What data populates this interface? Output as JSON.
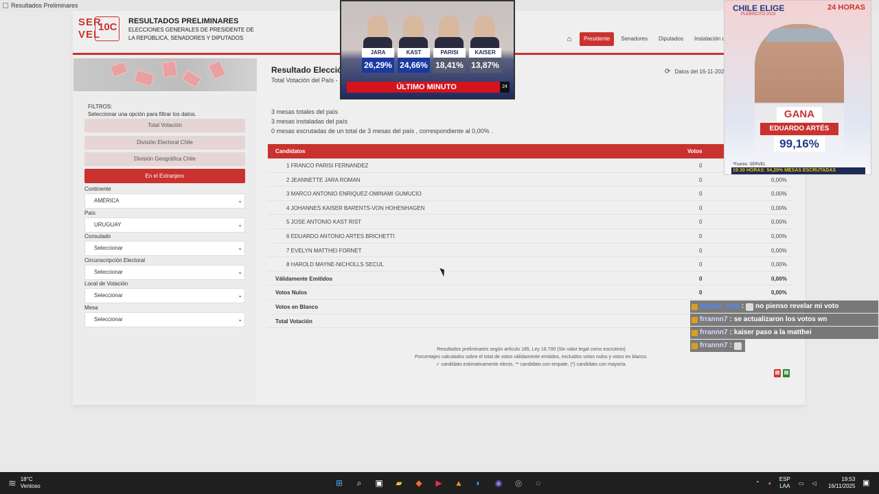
{
  "window": {
    "title": "Resultados Preliminares"
  },
  "header": {
    "logo": {
      "ser": "SER",
      "vel": "VEL",
      "badge": "10C"
    },
    "title": "RESULTADOS PRELIMINARES",
    "subtitle": "ELECCIONES GENERALES DE PRESIDENTE DE LA REPÚBLICA, SENADORES Y DIPUTADOS",
    "nav": [
      {
        "label": "Presidente",
        "active": true
      },
      {
        "label": "Senadores"
      },
      {
        "label": "Diputados"
      },
      {
        "label": "Instalación de M"
      }
    ]
  },
  "sidebar": {
    "filtros_title": "FILTROS:",
    "filtros_help": "Seleccionar una opción para filtrar los datos.",
    "buttons": [
      "Total Votación",
      "División Electoral Chile",
      "División Geográfica Chile",
      "En el Extranjero"
    ],
    "fields": [
      {
        "label": "Continente",
        "value": "AMÉRICA"
      },
      {
        "label": "País",
        "value": "URUGUAY"
      },
      {
        "label": "Consulado",
        "value": "Seleccionar"
      },
      {
        "label": "Circunscripción Electoral",
        "value": "Seleccionar"
      },
      {
        "label": "Local de Votación",
        "value": "Seleccionar"
      },
      {
        "label": "Mesa",
        "value": "Seleccionar"
      }
    ]
  },
  "main": {
    "title": "Resultado Elección",
    "subtitle": "Total Votación del País -",
    "date": "Datos del 16-11-2025",
    "stats": [
      "3 mesas totales del país",
      "3 mesas instaladas del país",
      "0 mesas escrutadas de un total de 3 mesas del país , correspondiente al 0,00% ."
    ],
    "table": {
      "headers": [
        "Candidatos",
        "Votos"
      ],
      "rows": [
        {
          "name": "1 FRANCO PARISI FERNANDEZ",
          "votes": "0",
          "pct": ""
        },
        {
          "name": "2 JEANNETTE JARA ROMAN",
          "votes": "0",
          "pct": "0,00%"
        },
        {
          "name": "3 MARCO ANTONIO ENRIQUEZ-OMINAMI GUMUCIO",
          "votes": "0",
          "pct": "0,00%"
        },
        {
          "name": "4 JOHANNES KAISER BARENTS-VON HOHENHAGEN",
          "votes": "0",
          "pct": "0,00%"
        },
        {
          "name": "5 JOSE ANTONIO KAST RIST",
          "votes": "0",
          "pct": "0,00%"
        },
        {
          "name": "6 EDUARDO ANTONIO ARTES BRICHETTI",
          "votes": "0",
          "pct": "0,00%"
        },
        {
          "name": "7 EVELYN MATTHEI FORNET",
          "votes": "0",
          "pct": "0,00%"
        },
        {
          "name": "8 HAROLD MAYNE-NICHOLLS SECUL",
          "votes": "0",
          "pct": "0,00%"
        }
      ],
      "totals": [
        {
          "name": "Válidamente Emitidos",
          "votes": "0",
          "pct": "0,00%"
        },
        {
          "name": "Votos Nulos",
          "votes": "0",
          "pct": "0,00%"
        },
        {
          "name": "Votos en Blanco",
          "votes": "",
          "pct": ""
        },
        {
          "name": "Total Votación",
          "votes": "",
          "pct": ""
        }
      ]
    },
    "notes": [
      "Resultados preliminares según artículo 185, Ley 18.700 (Sin valor legal como escrutinio)",
      "Porcentajes calculados sobre el total de votos válidamente emitidos, excluidos votos nulos y votos en blanco.",
      "✓ candidato estimativamente electo, ** candidato con empate, (*) candidato con mayoría."
    ]
  },
  "news_overlay": {
    "candidates": [
      {
        "name": "JARA",
        "pct": "26,29%"
      },
      {
        "name": "KAST",
        "pct": "24,66%"
      },
      {
        "name": "PARISI",
        "pct": "18,41%"
      },
      {
        "name": "KAISER",
        "pct": "13,87%"
      }
    ],
    "banner": "ÚLTIMO MINUTO",
    "channel": "24"
  },
  "result_overlay": {
    "brand": "CHILE ELIGE",
    "sub": "PLEBISCITO 2023",
    "channel": "24 HORAS",
    "gana": "GANA",
    "name": "EDUARDO ARTÉS",
    "pct": "99,16%",
    "fuente": "*Fuente: SERVEL",
    "escrutadas": "19:30 HORAS: 54,20% MESAS ESCRUTADAS"
  },
  "chat": [
    {
      "user": "felipee_cmb",
      "msg": "no pienso revelar mi voto",
      "blue": true
    },
    {
      "user": "frrannn7",
      "msg": "se actualizaron los votos wn"
    },
    {
      "user": "frrannn7",
      "msg": "kaiser paso a la matthei"
    },
    {
      "user": "frrannn7",
      "msg": ""
    }
  ],
  "taskbar": {
    "weather": {
      "temp": "18°C",
      "desc": "Ventoso"
    },
    "lang": [
      "ESP",
      "LAA"
    ],
    "time": "19:53",
    "date": "16/11/2025"
  },
  "colors": {
    "accent": "#c9322f",
    "tv_blue": "#1c2a55"
  }
}
